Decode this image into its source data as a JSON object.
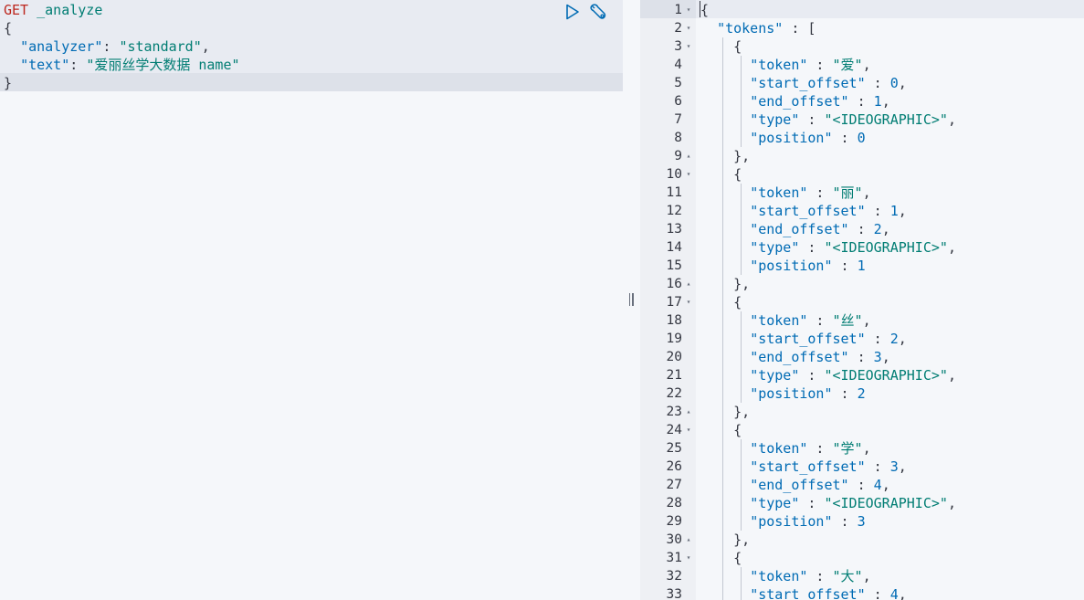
{
  "request": {
    "method": "GET",
    "path": "_analyze",
    "open_brace": "{",
    "close_brace": "}",
    "analyzer_key": "\"analyzer\"",
    "analyzer_value": "\"standard\"",
    "text_key": "\"text\"",
    "text_value": "\"爱丽丝学大数据 name\""
  },
  "actions": {
    "run_icon": "play-icon",
    "settings_icon": "wrench-icon"
  },
  "response": {
    "lines": [
      {
        "n": "1",
        "fold": "▾",
        "indent": 0,
        "text": "{"
      },
      {
        "n": "2",
        "fold": "▾",
        "indent": 1,
        "key": "\"tokens\"",
        "rest": " : ["
      },
      {
        "n": "3",
        "fold": "▾",
        "indent": 2,
        "text": "{"
      },
      {
        "n": "4",
        "fold": "",
        "indent": 3,
        "key": "\"token\"",
        "sep": " : ",
        "val": "\"爱\"",
        "vtype": "str",
        "tail": ","
      },
      {
        "n": "5",
        "fold": "",
        "indent": 3,
        "key": "\"start_offset\"",
        "sep": " : ",
        "val": "0",
        "vtype": "num",
        "tail": ","
      },
      {
        "n": "6",
        "fold": "",
        "indent": 3,
        "key": "\"end_offset\"",
        "sep": " : ",
        "val": "1",
        "vtype": "num",
        "tail": ","
      },
      {
        "n": "7",
        "fold": "",
        "indent": 3,
        "key": "\"type\"",
        "sep": " : ",
        "val": "\"<IDEOGRAPHIC>\"",
        "vtype": "str",
        "tail": ","
      },
      {
        "n": "8",
        "fold": "",
        "indent": 3,
        "key": "\"position\"",
        "sep": " : ",
        "val": "0",
        "vtype": "num",
        "tail": ""
      },
      {
        "n": "9",
        "fold": "▴",
        "indent": 2,
        "text": "},"
      },
      {
        "n": "10",
        "fold": "▾",
        "indent": 2,
        "text": "{"
      },
      {
        "n": "11",
        "fold": "",
        "indent": 3,
        "key": "\"token\"",
        "sep": " : ",
        "val": "\"丽\"",
        "vtype": "str",
        "tail": ","
      },
      {
        "n": "12",
        "fold": "",
        "indent": 3,
        "key": "\"start_offset\"",
        "sep": " : ",
        "val": "1",
        "vtype": "num",
        "tail": ","
      },
      {
        "n": "13",
        "fold": "",
        "indent": 3,
        "key": "\"end_offset\"",
        "sep": " : ",
        "val": "2",
        "vtype": "num",
        "tail": ","
      },
      {
        "n": "14",
        "fold": "",
        "indent": 3,
        "key": "\"type\"",
        "sep": " : ",
        "val": "\"<IDEOGRAPHIC>\"",
        "vtype": "str",
        "tail": ","
      },
      {
        "n": "15",
        "fold": "",
        "indent": 3,
        "key": "\"position\"",
        "sep": " : ",
        "val": "1",
        "vtype": "num",
        "tail": ""
      },
      {
        "n": "16",
        "fold": "▴",
        "indent": 2,
        "text": "},"
      },
      {
        "n": "17",
        "fold": "▾",
        "indent": 2,
        "text": "{"
      },
      {
        "n": "18",
        "fold": "",
        "indent": 3,
        "key": "\"token\"",
        "sep": " : ",
        "val": "\"丝\"",
        "vtype": "str",
        "tail": ","
      },
      {
        "n": "19",
        "fold": "",
        "indent": 3,
        "key": "\"start_offset\"",
        "sep": " : ",
        "val": "2",
        "vtype": "num",
        "tail": ","
      },
      {
        "n": "20",
        "fold": "",
        "indent": 3,
        "key": "\"end_offset\"",
        "sep": " : ",
        "val": "3",
        "vtype": "num",
        "tail": ","
      },
      {
        "n": "21",
        "fold": "",
        "indent": 3,
        "key": "\"type\"",
        "sep": " : ",
        "val": "\"<IDEOGRAPHIC>\"",
        "vtype": "str",
        "tail": ","
      },
      {
        "n": "22",
        "fold": "",
        "indent": 3,
        "key": "\"position\"",
        "sep": " : ",
        "val": "2",
        "vtype": "num",
        "tail": ""
      },
      {
        "n": "23",
        "fold": "▴",
        "indent": 2,
        "text": "},"
      },
      {
        "n": "24",
        "fold": "▾",
        "indent": 2,
        "text": "{"
      },
      {
        "n": "25",
        "fold": "",
        "indent": 3,
        "key": "\"token\"",
        "sep": " : ",
        "val": "\"学\"",
        "vtype": "str",
        "tail": ","
      },
      {
        "n": "26",
        "fold": "",
        "indent": 3,
        "key": "\"start_offset\"",
        "sep": " : ",
        "val": "3",
        "vtype": "num",
        "tail": ","
      },
      {
        "n": "27",
        "fold": "",
        "indent": 3,
        "key": "\"end_offset\"",
        "sep": " : ",
        "val": "4",
        "vtype": "num",
        "tail": ","
      },
      {
        "n": "28",
        "fold": "",
        "indent": 3,
        "key": "\"type\"",
        "sep": " : ",
        "val": "\"<IDEOGRAPHIC>\"",
        "vtype": "str",
        "tail": ","
      },
      {
        "n": "29",
        "fold": "",
        "indent": 3,
        "key": "\"position\"",
        "sep": " : ",
        "val": "3",
        "vtype": "num",
        "tail": ""
      },
      {
        "n": "30",
        "fold": "▴",
        "indent": 2,
        "text": "},"
      },
      {
        "n": "31",
        "fold": "▾",
        "indent": 2,
        "text": "{"
      },
      {
        "n": "32",
        "fold": "",
        "indent": 3,
        "key": "\"token\"",
        "sep": " : ",
        "val": "\"大\"",
        "vtype": "str",
        "tail": ","
      },
      {
        "n": "33",
        "fold": "",
        "indent": 3,
        "key": "\"start_offset\"",
        "sep": " : ",
        "val": "4",
        "vtype": "num",
        "tail": ","
      }
    ]
  },
  "colors": {
    "key": "#006bb4",
    "string": "#017d73",
    "number": "#006bb4",
    "method": "#bd271e",
    "punctuation": "#343741"
  }
}
